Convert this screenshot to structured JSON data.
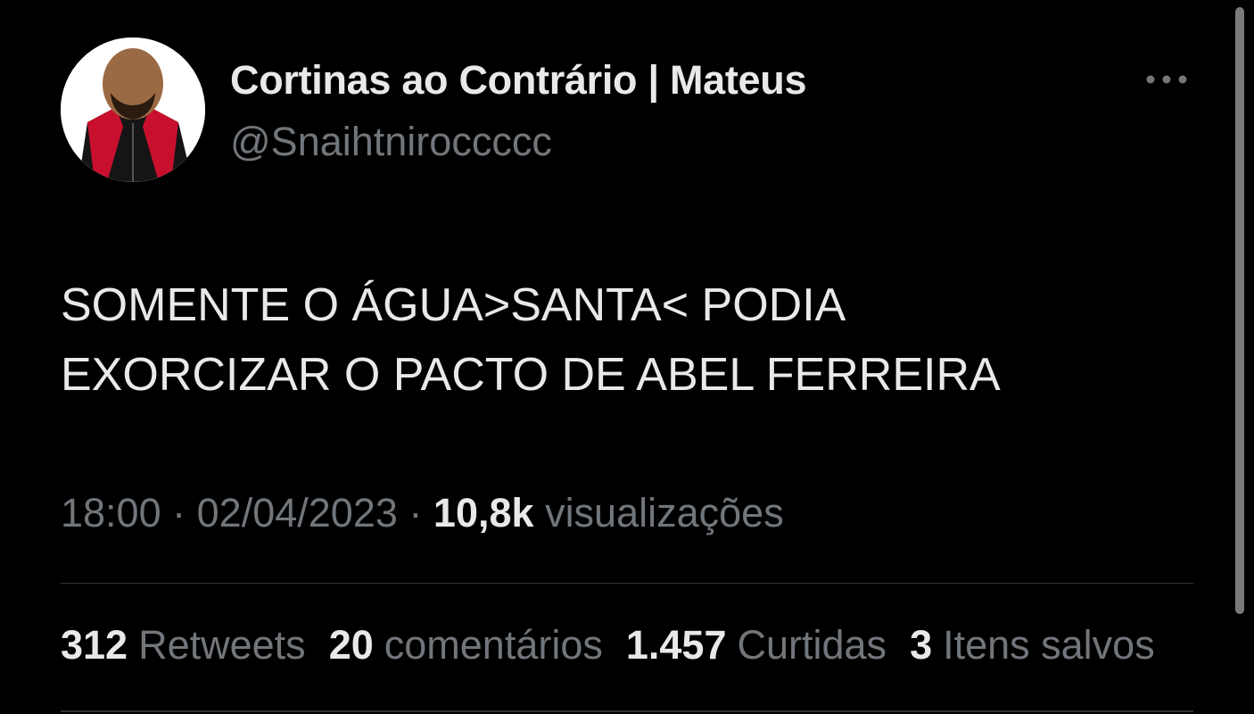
{
  "profile": {
    "display_name": "Cortinas ao Contrário | Mateus",
    "handle": "@Snaihtniroccccc",
    "avatar_icon": "cartoon-man-avatar-icon"
  },
  "more_icon": "more-horizontal-icon",
  "tweet": {
    "text": "SOMENTE O ÁGUA>SANTA< PODIA\nEXORCIZAR O PACTO DE ABEL FERREIRA"
  },
  "meta": {
    "time": "18:00",
    "separator": "·",
    "date": "02/04/2023",
    "views_count": "10,8k",
    "views_label": "visualizações"
  },
  "stats": [
    {
      "count": "312",
      "label": "Retweets"
    },
    {
      "count": "20",
      "label": "comentários"
    },
    {
      "count": "1.457",
      "label": "Curtidas"
    },
    {
      "count": "3",
      "label": "Itens salvos"
    }
  ],
  "colors": {
    "background": "#000000",
    "primary_text": "#e7e9ea",
    "secondary_text": "#71767b",
    "divider": "#2f3336"
  }
}
